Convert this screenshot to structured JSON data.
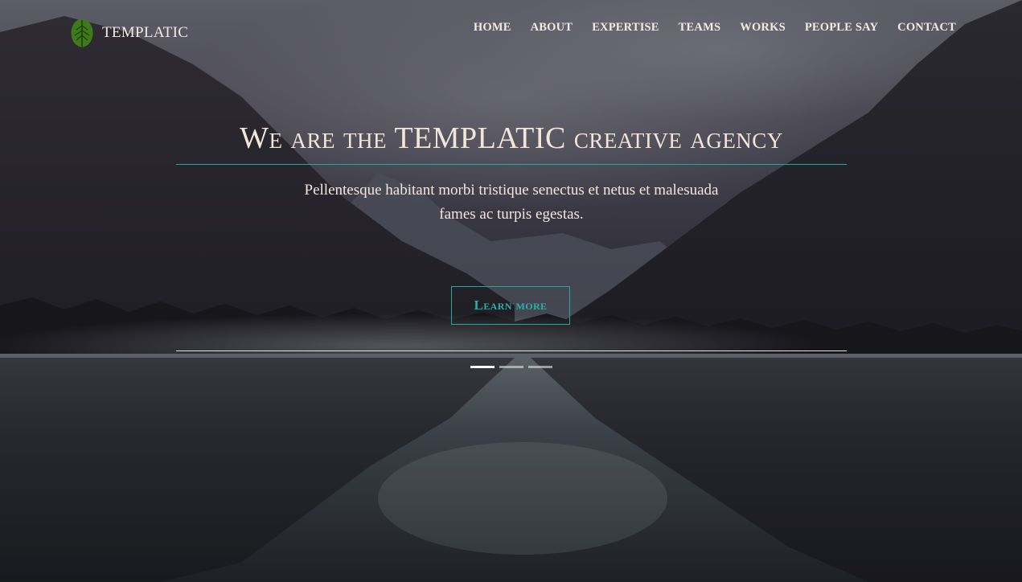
{
  "brand": {
    "name": "TEMPLATIC",
    "logo_icon": "leaf-icon",
    "logo_color": "#3f7a1a"
  },
  "nav": {
    "items": [
      {
        "label": "HOME"
      },
      {
        "label": "ABOUT"
      },
      {
        "label": "EXPERTISE"
      },
      {
        "label": "TEAMS"
      },
      {
        "label": "WORKS"
      },
      {
        "label": "PEOPLE SAY"
      },
      {
        "label": "CONTACT"
      }
    ]
  },
  "hero": {
    "headline": "We are the TEMPLATIC creative agency",
    "subtitle": "Pellentesque habitant morbi tristique senectus et netus et malesuada fames ac turpis egestas.",
    "cta_label": "Learn more",
    "slides": [
      {
        "active": true
      },
      {
        "active": false
      },
      {
        "active": false
      }
    ]
  },
  "colors": {
    "accent": "#28a6a0",
    "text": "#f1e6da"
  }
}
